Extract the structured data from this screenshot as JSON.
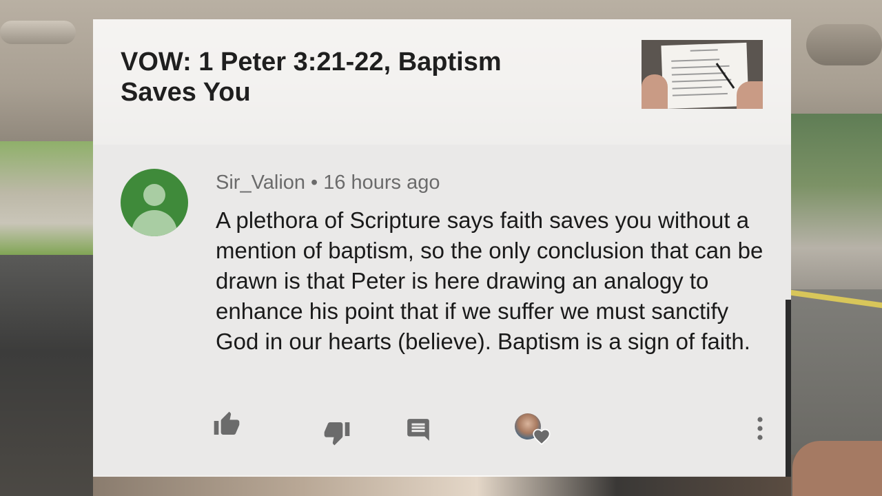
{
  "video": {
    "title": "VOW: 1 Peter 3:21-22, Baptism Saves You"
  },
  "comment": {
    "author": "Sir_Valion",
    "separator": "•",
    "timestamp": "16 hours ago",
    "text": "A plethora of Scripture says faith saves you without a mention of baptism, so the only conclusion that can be drawn is that Peter is here drawing an analogy to enhance his point that if we suffer we must sanctify God in our hearts (believe). Baptism is a sign of faith."
  },
  "actions": {
    "icons": [
      "thumbs-up-icon",
      "thumbs-down-icon",
      "reply-icon",
      "creator-heart-icon",
      "more-vertical-icon"
    ]
  },
  "colors": {
    "avatar_bg": "#3f8a3a",
    "title": "#1f1f1f",
    "meta": "#6b6b6b",
    "text": "#1a1a1a",
    "icon": "#6b6b6b"
  }
}
